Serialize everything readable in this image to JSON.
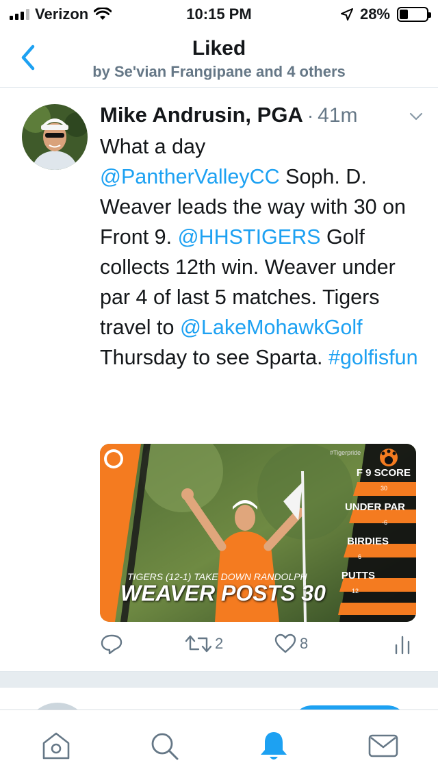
{
  "status_bar": {
    "carrier": "Verizon",
    "time": "10:15 PM",
    "battery": "28%"
  },
  "nav": {
    "title": "Liked",
    "subtitle": "by Se'vian Frangipane and 4 others"
  },
  "tweet": {
    "author": "Mike Andrusin, PGA",
    "separator": "·",
    "time": "41m",
    "text": {
      "t1": "What a day",
      "m1": "@PantherValleyCC",
      "t2": "  Soph. D. Weaver leads the way with 30 on Front 9. ",
      "m2": "@HHSTIGERS",
      "t3": " Golf collects 12th win. Weaver under par 4 of last 5 matches. Tigers travel to ",
      "m3": "@LakeMohawkGolf",
      "t4": " Thursday to see Sparta. ",
      "h1": "#golfisfun"
    },
    "media": {
      "headline_top": "TIGERS (12-1) TAKE DOWN RANDOLPH",
      "headline_main": "WEAVER POSTS 30",
      "hashtag": "#Tigerpride",
      "stats": [
        {
          "label": "F 9 SCORE",
          "value": "30"
        },
        {
          "label": "UNDER PAR",
          "value": "-6"
        },
        {
          "label": "BIRDIES",
          "value": "6"
        },
        {
          "label": "PUTTS",
          "value": "12"
        }
      ]
    },
    "actions": {
      "retweets": "2",
      "likes": "8"
    }
  },
  "colors": {
    "link": "#1da1f2",
    "accent_orange": "#f47b20",
    "muted": "#657786"
  },
  "tabbar": {
    "items": [
      "home-icon",
      "search-icon",
      "notifications-icon",
      "messages-icon"
    ]
  }
}
